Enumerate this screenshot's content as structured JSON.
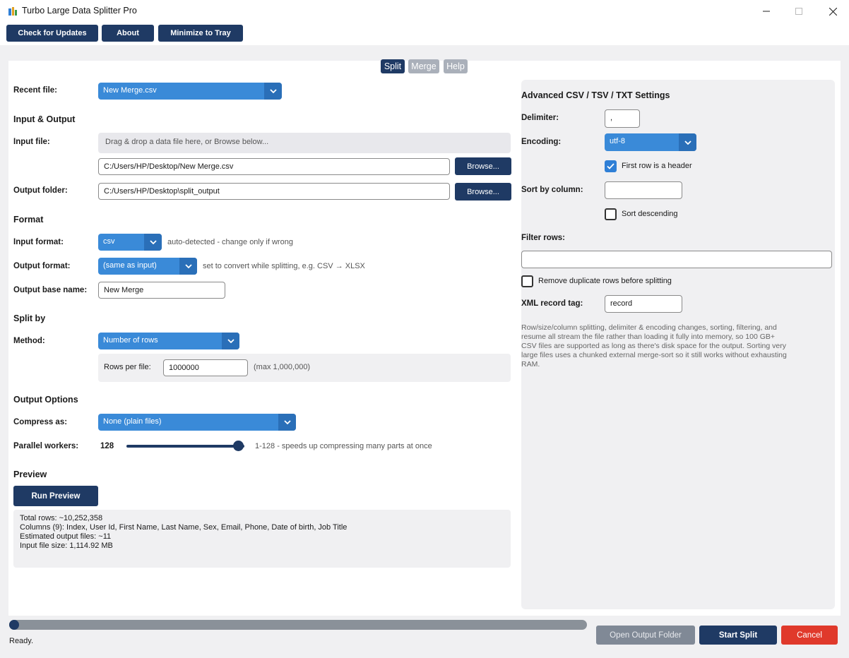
{
  "window": {
    "title": "Turbo Large Data Splitter Pro"
  },
  "toolbar": {
    "check_updates": "Check for Updates",
    "about": "About",
    "minimize_tray": "Minimize to Tray"
  },
  "tabs": {
    "split": "Split",
    "merge": "Merge",
    "help": "Help"
  },
  "recent": {
    "label": "Recent file:",
    "value": "New Merge.csv"
  },
  "io": {
    "heading": "Input & Output",
    "input_label": "Input file:",
    "dropzone": "Drag & drop a data file here, or Browse below...",
    "input_path": "C:/Users/HP/Desktop/New Merge.csv",
    "browse": "Browse...",
    "output_label": "Output folder:",
    "output_path": "C:/Users/HP/Desktop\\split_output"
  },
  "format": {
    "heading": "Format",
    "input_label": "Input format:",
    "input_value": "csv",
    "input_hint": "auto-detected - change only if wrong",
    "output_label": "Output format:",
    "output_value": "(same as input)",
    "output_hint": "set to convert while splitting, e.g. CSV → XLSX",
    "base_label": "Output base name:",
    "base_value": "New Merge"
  },
  "split_by": {
    "heading": "Split by",
    "method_label": "Method:",
    "method_value": "Number of rows",
    "rows_label": "Rows per file:",
    "rows_value": "1000000",
    "rows_hint": "(max 1,000,000)"
  },
  "output_options": {
    "heading": "Output Options",
    "compress_label": "Compress as:",
    "compress_value": "None (plain files)",
    "workers_label": "Parallel workers:",
    "workers_value": "128",
    "workers_hint": "1-128 - speeds up compressing many parts at once",
    "workers_level": 1.0
  },
  "preview": {
    "heading": "Preview",
    "run_button": "Run Preview",
    "lines": [
      "Total rows: ~10,252,358",
      "Columns (9): Index, User Id, First Name, Last Name, Sex, Email, Phone, Date of birth, Job Title",
      "Estimated output files: ~11",
      "Input file size: 1,114.92 MB"
    ]
  },
  "advanced": {
    "heading": "Advanced CSV / TSV / TXT Settings",
    "delimiter_label": "Delimiter:",
    "delimiter_value": ",",
    "encoding_label": "Encoding:",
    "encoding_value": "utf-8",
    "header_label": "First row is a header",
    "header_checked": true,
    "sort_label": "Sort by column:",
    "sort_value": "",
    "sort_desc_label": "Sort descending",
    "sort_desc_checked": false,
    "filter_label": "Filter rows:",
    "filter_value": "",
    "dedupe_label": "Remove duplicate rows before splitting",
    "dedupe_checked": false,
    "xml_label": "XML record tag:",
    "xml_value": "record",
    "note": "Row/size/column splitting, delimiter & encoding changes, sorting, filtering, and resume all stream the file rather than loading it fully into memory, so 100 GB+ CSV files are supported as long as there's disk space for the output. Sorting very large files uses a chunked external merge-sort so it still works without exhausting RAM."
  },
  "footer": {
    "status": "Ready.",
    "progress": 0,
    "open_folder": "Open Output Folder",
    "start": "Start Split",
    "cancel": "Cancel"
  },
  "colors": {
    "primary": "#1f3a64",
    "accent": "#3a8ad8",
    "danger": "#e0392b",
    "disabled": "#808996"
  }
}
